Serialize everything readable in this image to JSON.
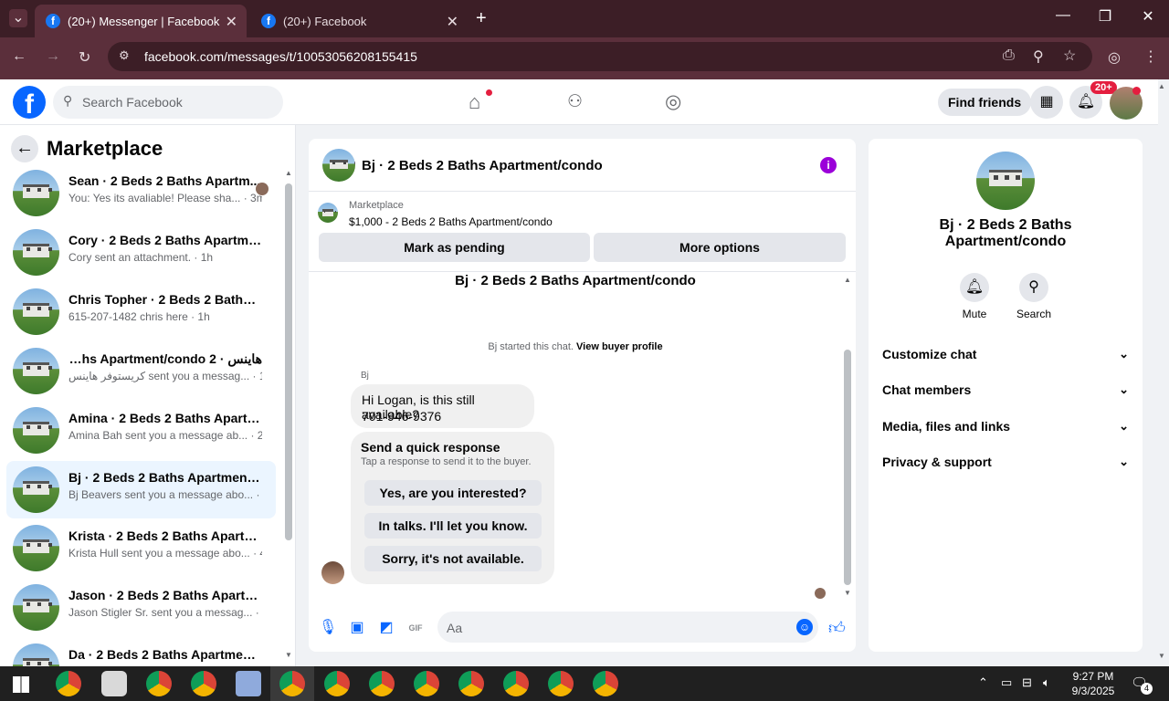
{
  "browser": {
    "tabs": [
      {
        "title": "(20+) Messenger | Facebook",
        "active": true
      },
      {
        "title": "(20+) Facebook",
        "active": false
      }
    ],
    "url": "facebook.com/messages/t/10053056208155415"
  },
  "fb_header": {
    "search_placeholder": "Search Facebook",
    "find_friends": "Find friends",
    "notifications_badge": "20+"
  },
  "left": {
    "title": "Marketplace",
    "conversations": [
      {
        "name": "Sean · 2 Beds 2 Baths Apartm...",
        "snippet": "You: Yes its avaliable! Please sha... · 3m",
        "selected": false
      },
      {
        "name": "Cory · 2 Beds 2 Baths Apartmen...",
        "snippet": "Cory sent an attachment. · 1h",
        "selected": false
      },
      {
        "name": "Chris Topher · 2 Beds 2 Baths Ap...",
        "snippet": "615-207-1482 chris here · 1h",
        "selected": false
      },
      {
        "name": "هاينس · 2 Beds 2 Baths Apartment/condo",
        "snippet": "كريستوفر هاينس sent you a messag... · 1h",
        "selected": false
      },
      {
        "name": "Amina · 2 Beds 2 Baths Apartme...",
        "snippet": "Amina Bah sent you a message ab... · 2h",
        "selected": false
      },
      {
        "name": "Bj · 2 Beds 2 Baths Apartment/c...",
        "snippet": "Bj Beavers sent you a message abo... · 4h",
        "selected": true
      },
      {
        "name": "Krista · 2 Beds 2 Baths Apartme...",
        "snippet": "Krista Hull sent you a message abo... · 4h",
        "selected": false
      },
      {
        "name": "Jason · 2 Beds 2 Baths Apartme...",
        "snippet": "Jason Stigler Sr. sent you a messag... · 5h",
        "selected": false
      },
      {
        "name": "Da · 2 Beds 2 Baths Apartment/...",
        "snippet": "",
        "selected": false
      }
    ]
  },
  "chat": {
    "title": "Bj · 2 Beds 2 Baths Apartment/condo",
    "marketplace_label": "Marketplace",
    "listing": "$1,000 - 2 Beds 2 Baths Apartment/condo",
    "mark_pending": "Mark as pending",
    "more_options": "More options",
    "intro_title": "Bj · 2 Beds 2 Baths Apartment/condo",
    "started_text": "Bj started this chat.",
    "view_buyer": "View buyer profile",
    "sender": "Bj",
    "message_line1": "Hi Logan, is this still available?",
    "message_line2": "701-946-9376",
    "quick_title": "Send a quick response",
    "quick_sub": "Tap a response to send it to the buyer.",
    "quick_responses": [
      "Yes, are you interested?",
      "In talks. I'll let you know.",
      "Sorry, it's not available."
    ],
    "composer_placeholder": "Aa"
  },
  "right": {
    "title": "Bj · 2 Beds 2 Baths Apartment/condo",
    "actions": [
      "Mute",
      "Search"
    ],
    "sections": [
      "Customize chat",
      "Chat members",
      "Media, files and links",
      "Privacy & support"
    ]
  },
  "taskbar": {
    "time": "9:27 PM",
    "date": "9/3/2025",
    "notif_count": "4"
  },
  "colors": {
    "chrome_dark": "#3c1e26",
    "chrome_mid": "#5b2f3b",
    "fb_blue": "#0866ff",
    "selected_bg": "#ebf5ff",
    "info_purple": "#9b00d9"
  }
}
